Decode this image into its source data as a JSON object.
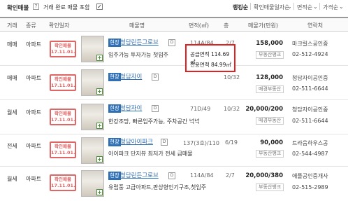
{
  "filters": {
    "title": "확인매물",
    "help": "?",
    "include_completed": "거래 완료 매물 포함",
    "include_checked": "✓",
    "sort": [
      "랭킹순",
      "확인매물일자순",
      "면적순",
      "가격순"
    ],
    "sort_arrow": "⌄"
  },
  "columns": [
    "거래",
    "종류",
    "확인일자",
    "매물명",
    "면적(㎡)",
    "층",
    "매물가(만원)",
    "연락처"
  ],
  "listings": [
    {
      "deal": "매매",
      "type": "아파트",
      "stamp_top": "확인매물",
      "stamp_date": "17.11.01.",
      "badge": "현장",
      "name": "청담린든그로브",
      "dbox": "D",
      "desc": "입주가능 투자가능 첫입주",
      "area": "114A/84",
      "floor": "2/7",
      "price": "158,000",
      "agent_btn": "부동산뱅크",
      "agent": "마크릴스공인중",
      "phone": "02-512-4924"
    },
    {
      "deal": "매매",
      "type": "아파트",
      "stamp_top": "확인매물",
      "stamp_date": "17.11.01.",
      "badge": "현장",
      "name": "청담자이",
      "dbox": "D",
      "desc": "",
      "area": "",
      "floor": "10/32",
      "price": "128,000",
      "agent_btn": "매경부동산",
      "agent": "청담자이공인중",
      "phone": "02-511-6644"
    },
    {
      "deal": "월세",
      "type": "아파트",
      "stamp_top": "확인매물",
      "stamp_date": "17.11.01.",
      "badge": "현장",
      "name": "청담자이",
      "dbox": "D",
      "desc": "한강조망, 빠른입주가능, 주차공간 넉넉",
      "area": "71D/49",
      "floor": "10/32",
      "price": "20,000/200",
      "agent_btn": "매경부동산",
      "agent": "청담자이공인중",
      "phone": "02-511-6644"
    },
    {
      "deal": "전세",
      "type": "아파트",
      "stamp_top": "확인매물",
      "stamp_date": "17.11.01.",
      "badge": "현장",
      "name": "청담아이파크",
      "dbox": "D",
      "desc": "아이파크 단지뷰 최저가 전세 급매물",
      "area": "137(3호)/110",
      "floor": "6/19",
      "price": "90,000",
      "agent_btn": "부동산뱅크",
      "agent": "트라움하우스공",
      "phone": "02-544-4987"
    },
    {
      "deal": "월세",
      "type": "아파트",
      "stamp_top": "확인매물",
      "stamp_date": "17.11.01.",
      "badge": "현장",
      "name": "청담린든그로브",
      "dbox": "D",
      "desc": "유럽풍 고급아파트,판상형인기구조,첫입주",
      "area": "114A/84",
      "floor": "2/7",
      "price": "20,000/380",
      "agent_btn": "부동산뱅크",
      "agent": "애플공인중개사",
      "phone": "02-515-2989"
    }
  ],
  "popup": {
    "supply": "공급면적 114.69㎡",
    "exclusive": "전용면적 84.99㎡"
  },
  "colors": {
    "accent": "#2f6fb4",
    "stamp": "#e06666",
    "highlight": "#e32020"
  }
}
